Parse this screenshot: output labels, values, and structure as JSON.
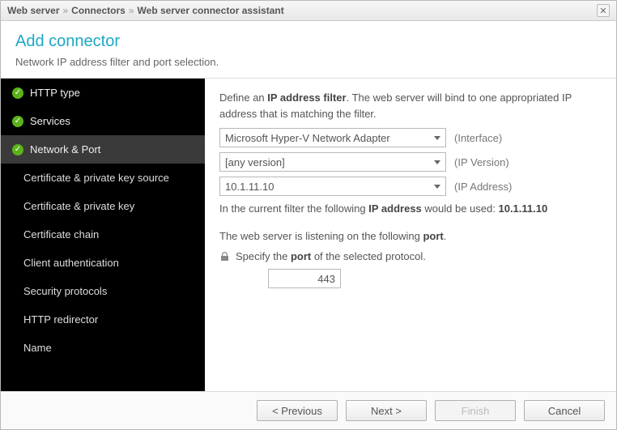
{
  "breadcrumb": {
    "items": [
      "Web server",
      "Connectors",
      "Web server connector assistant"
    ],
    "sep": "»"
  },
  "header": {
    "title": "Add connector",
    "subtitle": "Network IP address filter and port selection."
  },
  "sidebar": {
    "items": [
      {
        "label": "HTTP type",
        "checked": true,
        "active": false,
        "sub": false
      },
      {
        "label": "Services",
        "checked": true,
        "active": false,
        "sub": false
      },
      {
        "label": "Network & Port",
        "checked": true,
        "active": true,
        "sub": false
      },
      {
        "label": "Certificate & private key source",
        "checked": false,
        "active": false,
        "sub": true
      },
      {
        "label": "Certificate & private key",
        "checked": false,
        "active": false,
        "sub": true
      },
      {
        "label": "Certificate chain",
        "checked": false,
        "active": false,
        "sub": true
      },
      {
        "label": "Client authentication",
        "checked": false,
        "active": false,
        "sub": true
      },
      {
        "label": "Security protocols",
        "checked": false,
        "active": false,
        "sub": true
      },
      {
        "label": "HTTP redirector",
        "checked": false,
        "active": false,
        "sub": true
      },
      {
        "label": "Name",
        "checked": false,
        "active": false,
        "sub": true
      }
    ]
  },
  "main": {
    "intro_prefix": "Define an ",
    "intro_bold": "IP address filter",
    "intro_suffix": ". The web server will bind to one appropriated IP address that is matching the filter.",
    "interface": {
      "value": "Microsoft Hyper-V Network Adapter",
      "label": "(Interface)"
    },
    "ipversion": {
      "value": "[any version]",
      "label": "(IP Version)"
    },
    "ipaddress": {
      "value": "10.1.11.10",
      "label": "(IP Address)"
    },
    "current_prefix": "In the current filter the following ",
    "current_bold1": "IP address",
    "current_mid": " would be used: ",
    "current_bold2": "10.1.11.10",
    "listening_prefix": "The web server is listening on the following ",
    "listening_bold": "port",
    "listening_suffix": ".",
    "specify_prefix": "Specify the ",
    "specify_bold": "port",
    "specify_suffix": " of the selected protocol.",
    "port_value": "443"
  },
  "footer": {
    "previous": "< Previous",
    "next": "Next >",
    "finish": "Finish",
    "cancel": "Cancel"
  }
}
